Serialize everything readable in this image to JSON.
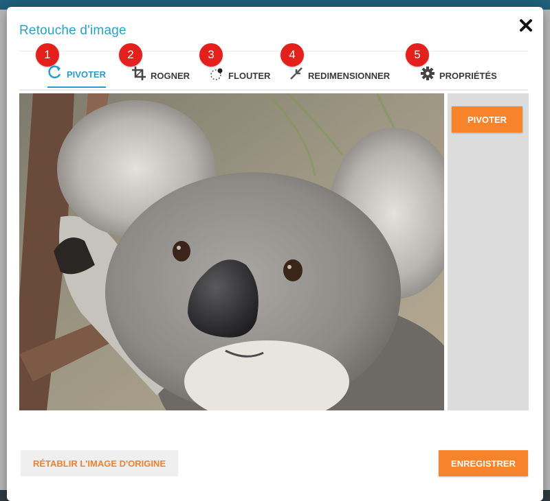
{
  "dialog": {
    "title": "Retouche d'image"
  },
  "tabs": [
    {
      "label": "PIVOTER",
      "badge": "1",
      "icon": "rotate-icon",
      "active": true
    },
    {
      "label": "ROGNER",
      "badge": "2",
      "icon": "crop-icon",
      "active": false
    },
    {
      "label": "FLOUTER",
      "badge": "3",
      "icon": "blur-icon",
      "active": false
    },
    {
      "label": "REDIMENSIONNER",
      "badge": "4",
      "icon": "resize-icon",
      "active": false
    },
    {
      "label": "PROPRIÉTÉS",
      "badge": "5",
      "icon": "gear-icon",
      "active": false
    }
  ],
  "side_panel": {
    "action_label": "PIVOTER"
  },
  "footer": {
    "reset_label": "RÉTABLIR L'IMAGE D'ORIGINE",
    "save_label": "ENREGISTRER"
  },
  "colors": {
    "accent": "#2b9dcc",
    "action": "#f7832a",
    "badge": "#e3201b"
  }
}
